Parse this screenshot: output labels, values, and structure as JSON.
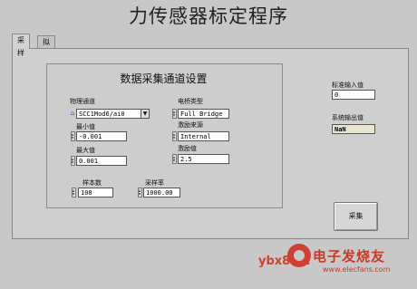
{
  "app": {
    "title": "力传感器标定程序"
  },
  "tabs": [
    {
      "label": "采样",
      "active": true
    },
    {
      "label": "拟合",
      "active": false
    }
  ],
  "daq": {
    "title": "数据采集通道设置",
    "physical_channel": {
      "label": "物理通道",
      "value": "SCC1Mod6/ai0"
    },
    "min": {
      "label": "最小值",
      "value": "-0.001"
    },
    "max": {
      "label": "最大值",
      "value": "0.001"
    },
    "bridge_type": {
      "label": "电桥类型",
      "value": "Full Bridge"
    },
    "excitation_source": {
      "label": "激励来源",
      "value": "Internal"
    },
    "excitation_value": {
      "label": "激励值",
      "value": "2.5"
    },
    "samples": {
      "label": "样本数",
      "value": "100"
    },
    "rate": {
      "label": "采样率",
      "value": "1000.00"
    }
  },
  "side": {
    "standard_input": {
      "label": "标准输入值",
      "value": "0"
    },
    "system_output": {
      "label": "系统输出值",
      "value": "NaN"
    }
  },
  "actions": {
    "acquire_label": "采集"
  },
  "watermark": {
    "site": "ybx8.cn",
    "brand": "电子发烧友",
    "url": "www.elecfans.com"
  },
  "colors": {
    "background": "#c8c8c8",
    "watermark": "#c83a28",
    "readonly_field": "#e9e6d4"
  }
}
